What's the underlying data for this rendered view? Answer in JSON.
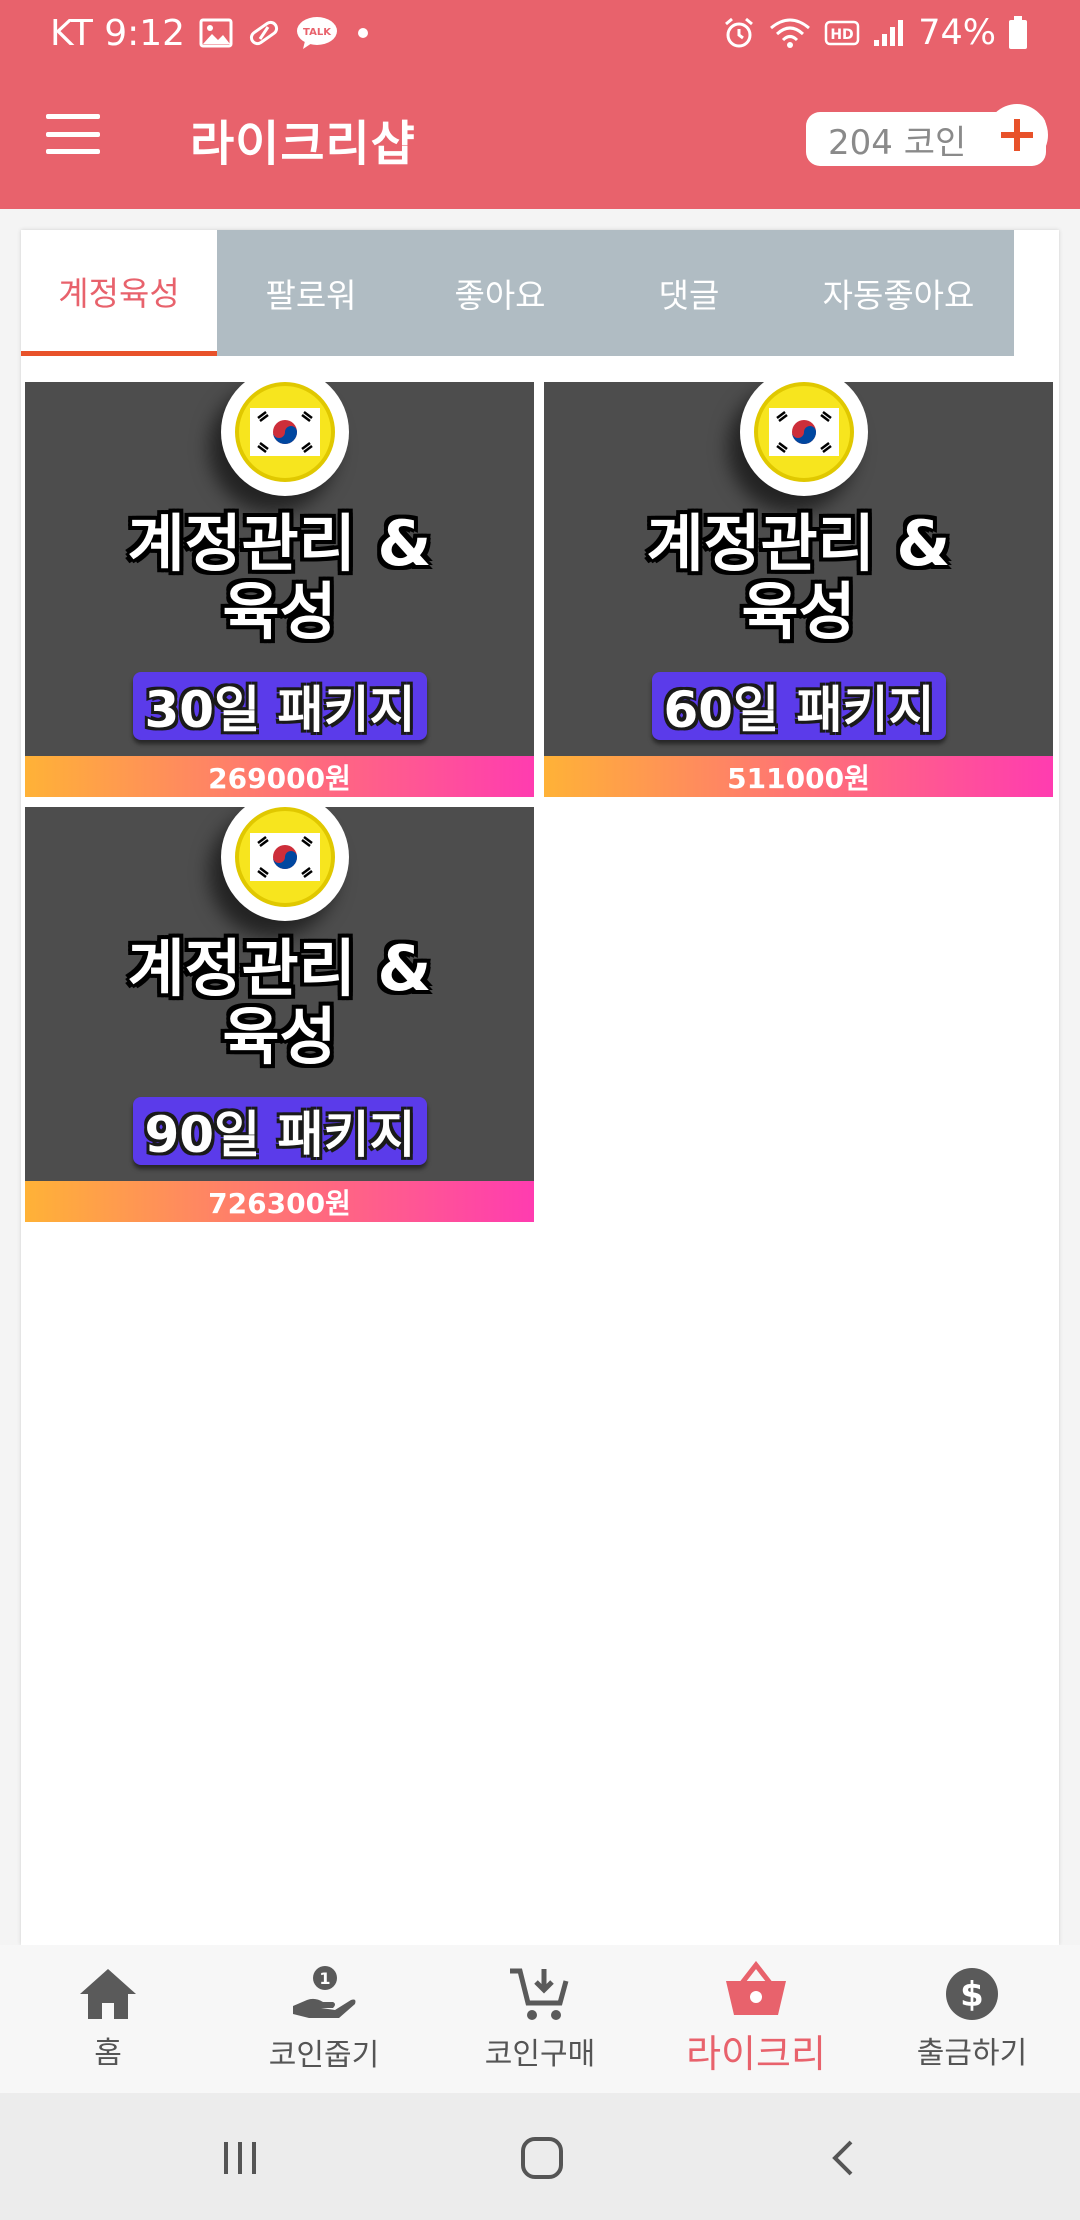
{
  "status_bar": {
    "carrier_time": "KT 9:12",
    "battery": "74%",
    "talk_label": "TALK",
    "left_icons": [
      "image-icon",
      "pill-icon",
      "kakaotalk-icon",
      "dot-icon"
    ],
    "right_icons": [
      "alarm-icon",
      "wifi-icon",
      "hd-icon",
      "signal-icon",
      "battery-icon"
    ]
  },
  "app_bar": {
    "title": "라이크리샵",
    "coin_balance": "204 코인",
    "menu_icon": "hamburger-menu-icon",
    "add_icon": "plus-icon"
  },
  "tabs": [
    {
      "label": "계정육성",
      "active": true
    },
    {
      "label": "팔로워",
      "active": false
    },
    {
      "label": "좋아요",
      "active": false
    },
    {
      "label": "댓글",
      "active": false
    },
    {
      "label": "자동좋아요",
      "active": false
    }
  ],
  "products": [
    {
      "title_line1": "계정관리 &",
      "title_line2": "육성",
      "badge": "30일 패키지",
      "price": "269000원"
    },
    {
      "title_line1": "계정관리 &",
      "title_line2": "육성",
      "badge": "60일 패키지",
      "price": "511000원"
    },
    {
      "title_line1": "계정관리 &",
      "title_line2": "육성",
      "badge": "90일 패키지",
      "price": "726300원"
    }
  ],
  "bottom_nav": [
    {
      "label": "홈",
      "icon": "home-icon",
      "active": false
    },
    {
      "label": "코인줍기",
      "icon": "hand-coin-icon",
      "active": false,
      "badge": "1"
    },
    {
      "label": "코인구매",
      "icon": "cart-download-icon",
      "active": false
    },
    {
      "label": "라이크리",
      "icon": "basket-icon",
      "active": true
    },
    {
      "label": "출금하기",
      "icon": "dollar-icon",
      "active": false
    }
  ],
  "system_nav": [
    "recent-apps-icon",
    "home-circle-icon",
    "back-icon"
  ],
  "colors": {
    "header": "#e8626c",
    "tab_inactive": "#b0bcc3",
    "tab_indicator": "#e8522a",
    "badge": "#5b3bea",
    "price_gradient_start": "#ffb237",
    "price_gradient_end": "#ff3cb0"
  }
}
